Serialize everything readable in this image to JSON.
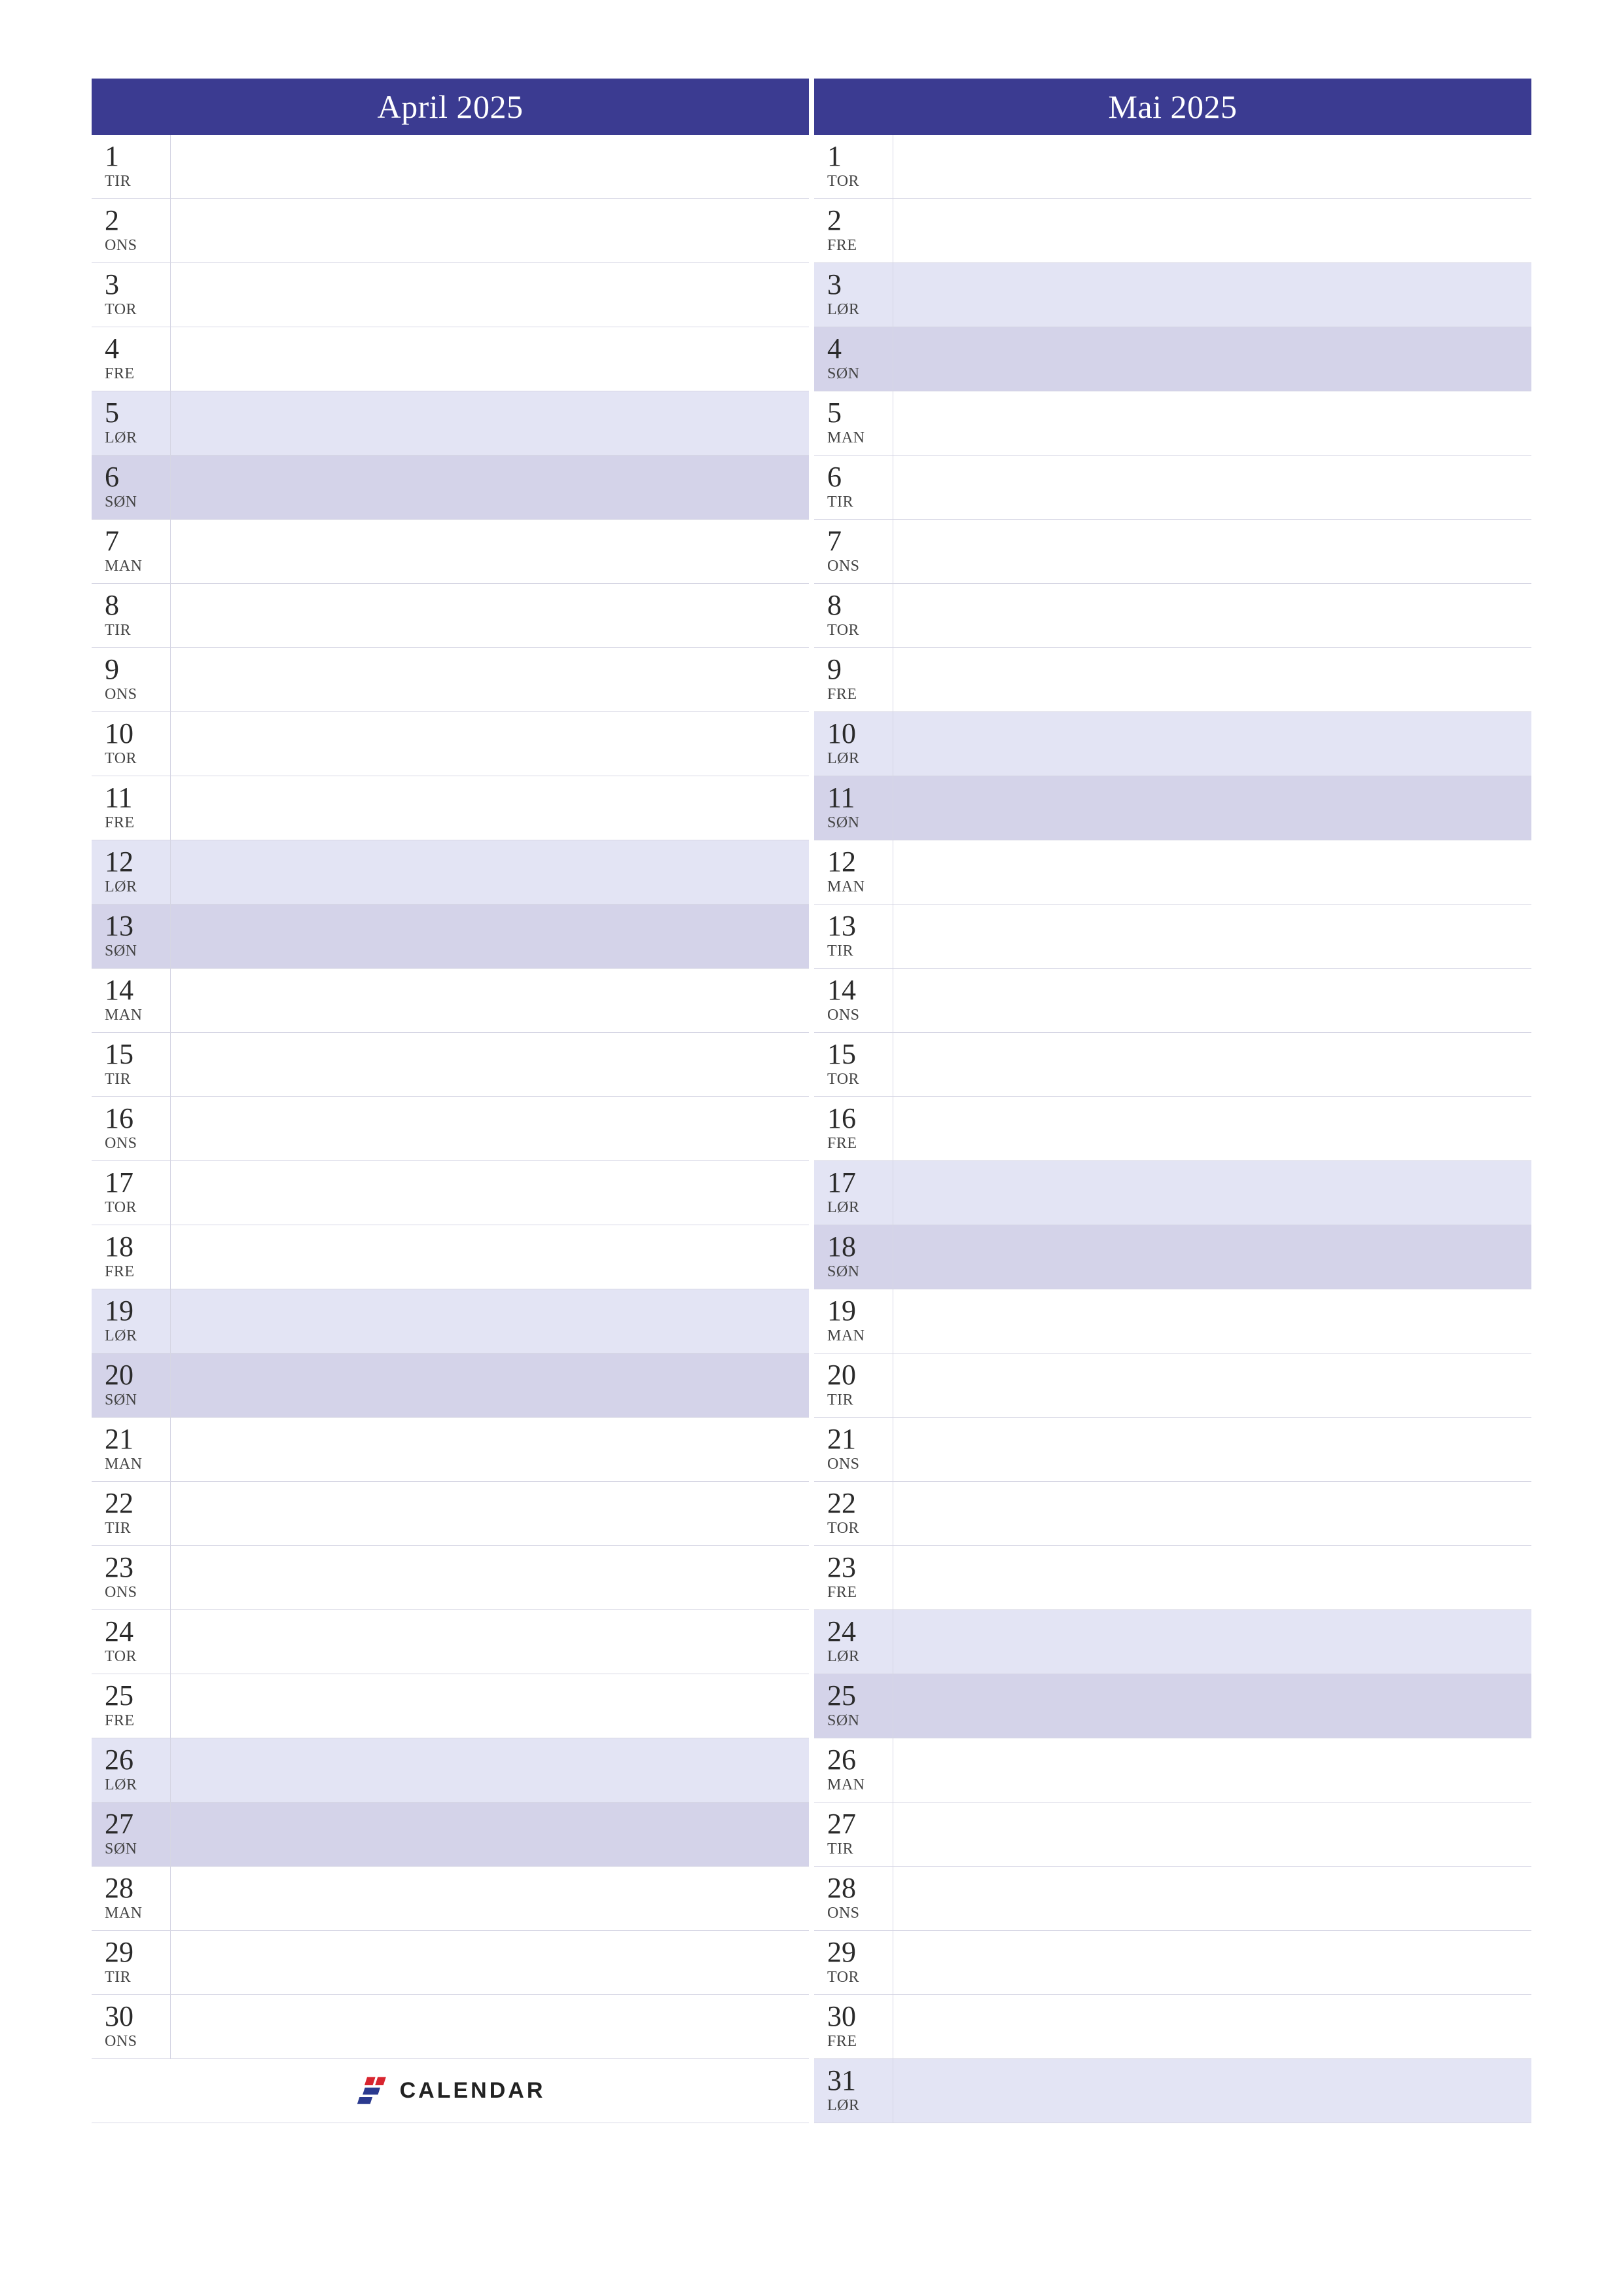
{
  "colors": {
    "header_bg": "#3b3b91",
    "sat_bg": "#e3e4f4",
    "sun_bg": "#d4d3e9"
  },
  "brand": {
    "name": "CALENDAR"
  },
  "months": [
    {
      "title": "April 2025",
      "footer_is_brand": true,
      "days": [
        {
          "num": "1",
          "dow": "TIR",
          "type": "weekday"
        },
        {
          "num": "2",
          "dow": "ONS",
          "type": "weekday"
        },
        {
          "num": "3",
          "dow": "TOR",
          "type": "weekday"
        },
        {
          "num": "4",
          "dow": "FRE",
          "type": "weekday"
        },
        {
          "num": "5",
          "dow": "LØR",
          "type": "sat"
        },
        {
          "num": "6",
          "dow": "SØN",
          "type": "sun"
        },
        {
          "num": "7",
          "dow": "MAN",
          "type": "weekday"
        },
        {
          "num": "8",
          "dow": "TIR",
          "type": "weekday"
        },
        {
          "num": "9",
          "dow": "ONS",
          "type": "weekday"
        },
        {
          "num": "10",
          "dow": "TOR",
          "type": "weekday"
        },
        {
          "num": "11",
          "dow": "FRE",
          "type": "weekday"
        },
        {
          "num": "12",
          "dow": "LØR",
          "type": "sat"
        },
        {
          "num": "13",
          "dow": "SØN",
          "type": "sun"
        },
        {
          "num": "14",
          "dow": "MAN",
          "type": "weekday"
        },
        {
          "num": "15",
          "dow": "TIR",
          "type": "weekday"
        },
        {
          "num": "16",
          "dow": "ONS",
          "type": "weekday"
        },
        {
          "num": "17",
          "dow": "TOR",
          "type": "weekday"
        },
        {
          "num": "18",
          "dow": "FRE",
          "type": "weekday"
        },
        {
          "num": "19",
          "dow": "LØR",
          "type": "sat"
        },
        {
          "num": "20",
          "dow": "SØN",
          "type": "sun"
        },
        {
          "num": "21",
          "dow": "MAN",
          "type": "weekday"
        },
        {
          "num": "22",
          "dow": "TIR",
          "type": "weekday"
        },
        {
          "num": "23",
          "dow": "ONS",
          "type": "weekday"
        },
        {
          "num": "24",
          "dow": "TOR",
          "type": "weekday"
        },
        {
          "num": "25",
          "dow": "FRE",
          "type": "weekday"
        },
        {
          "num": "26",
          "dow": "LØR",
          "type": "sat"
        },
        {
          "num": "27",
          "dow": "SØN",
          "type": "sun"
        },
        {
          "num": "28",
          "dow": "MAN",
          "type": "weekday"
        },
        {
          "num": "29",
          "dow": "TIR",
          "type": "weekday"
        },
        {
          "num": "30",
          "dow": "ONS",
          "type": "weekday"
        }
      ]
    },
    {
      "title": "Mai 2025",
      "footer_is_brand": false,
      "days": [
        {
          "num": "1",
          "dow": "TOR",
          "type": "weekday"
        },
        {
          "num": "2",
          "dow": "FRE",
          "type": "weekday"
        },
        {
          "num": "3",
          "dow": "LØR",
          "type": "sat"
        },
        {
          "num": "4",
          "dow": "SØN",
          "type": "sun"
        },
        {
          "num": "5",
          "dow": "MAN",
          "type": "weekday"
        },
        {
          "num": "6",
          "dow": "TIR",
          "type": "weekday"
        },
        {
          "num": "7",
          "dow": "ONS",
          "type": "weekday"
        },
        {
          "num": "8",
          "dow": "TOR",
          "type": "weekday"
        },
        {
          "num": "9",
          "dow": "FRE",
          "type": "weekday"
        },
        {
          "num": "10",
          "dow": "LØR",
          "type": "sat"
        },
        {
          "num": "11",
          "dow": "SØN",
          "type": "sun"
        },
        {
          "num": "12",
          "dow": "MAN",
          "type": "weekday"
        },
        {
          "num": "13",
          "dow": "TIR",
          "type": "weekday"
        },
        {
          "num": "14",
          "dow": "ONS",
          "type": "weekday"
        },
        {
          "num": "15",
          "dow": "TOR",
          "type": "weekday"
        },
        {
          "num": "16",
          "dow": "FRE",
          "type": "weekday"
        },
        {
          "num": "17",
          "dow": "LØR",
          "type": "sat"
        },
        {
          "num": "18",
          "dow": "SØN",
          "type": "sun"
        },
        {
          "num": "19",
          "dow": "MAN",
          "type": "weekday"
        },
        {
          "num": "20",
          "dow": "TIR",
          "type": "weekday"
        },
        {
          "num": "21",
          "dow": "ONS",
          "type": "weekday"
        },
        {
          "num": "22",
          "dow": "TOR",
          "type": "weekday"
        },
        {
          "num": "23",
          "dow": "FRE",
          "type": "weekday"
        },
        {
          "num": "24",
          "dow": "LØR",
          "type": "sat"
        },
        {
          "num": "25",
          "dow": "SØN",
          "type": "sun"
        },
        {
          "num": "26",
          "dow": "MAN",
          "type": "weekday"
        },
        {
          "num": "27",
          "dow": "TIR",
          "type": "weekday"
        },
        {
          "num": "28",
          "dow": "ONS",
          "type": "weekday"
        },
        {
          "num": "29",
          "dow": "TOR",
          "type": "weekday"
        },
        {
          "num": "30",
          "dow": "FRE",
          "type": "weekday"
        },
        {
          "num": "31",
          "dow": "LØR",
          "type": "sat"
        }
      ]
    }
  ]
}
